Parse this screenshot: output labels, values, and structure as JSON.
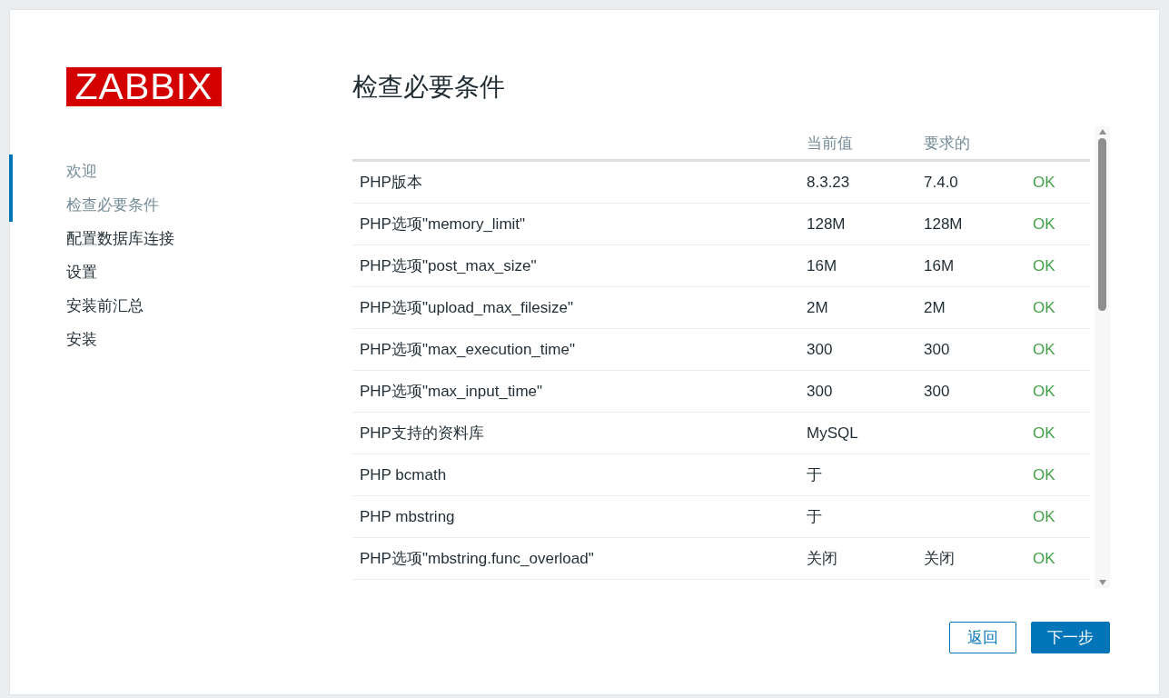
{
  "logo": {
    "text": "ZABBIX"
  },
  "steps": [
    {
      "label": "欢迎",
      "completed": true
    },
    {
      "label": "检查必要条件",
      "completed": true
    },
    {
      "label": "配置数据库连接",
      "completed": false
    },
    {
      "label": "设置",
      "completed": false
    },
    {
      "label": "安装前汇总",
      "completed": false
    },
    {
      "label": "安装",
      "completed": false
    }
  ],
  "title": "检查必要条件",
  "table": {
    "columns": [
      "当前值",
      "要求的"
    ],
    "rows": [
      {
        "name": "PHP版本",
        "current": "8.3.23",
        "required": "7.4.0",
        "result": "OK",
        "passed": true
      },
      {
        "name": "PHP选项\"memory_limit\"",
        "current": "128M",
        "required": "128M",
        "result": "OK",
        "passed": true
      },
      {
        "name": "PHP选项\"post_max_size\"",
        "current": "16M",
        "required": "16M",
        "result": "OK",
        "passed": true
      },
      {
        "name": "PHP选项\"upload_max_filesize\"",
        "current": "2M",
        "required": "2M",
        "result": "OK",
        "passed": true
      },
      {
        "name": "PHP选项\"max_execution_time\"",
        "current": "300",
        "required": "300",
        "result": "OK",
        "passed": true
      },
      {
        "name": "PHP选项\"max_input_time\"",
        "current": "300",
        "required": "300",
        "result": "OK",
        "passed": true
      },
      {
        "name": "PHP支持的资料库",
        "current": "MySQL",
        "result": "OK",
        "passed": true
      },
      {
        "name": "PHP bcmath",
        "current": "于",
        "result": "OK",
        "passed": true
      },
      {
        "name": "PHP mbstring",
        "current": "于",
        "result": "OK",
        "passed": true
      },
      {
        "name": "PHP选项\"mbstring.func_overload\"",
        "current": "关闭",
        "required": "关闭",
        "result": "OK",
        "passed": true
      }
    ]
  },
  "buttons": [
    {
      "label": "返回",
      "kind": "secondary"
    },
    {
      "label": "下一步",
      "kind": "primary"
    }
  ]
}
